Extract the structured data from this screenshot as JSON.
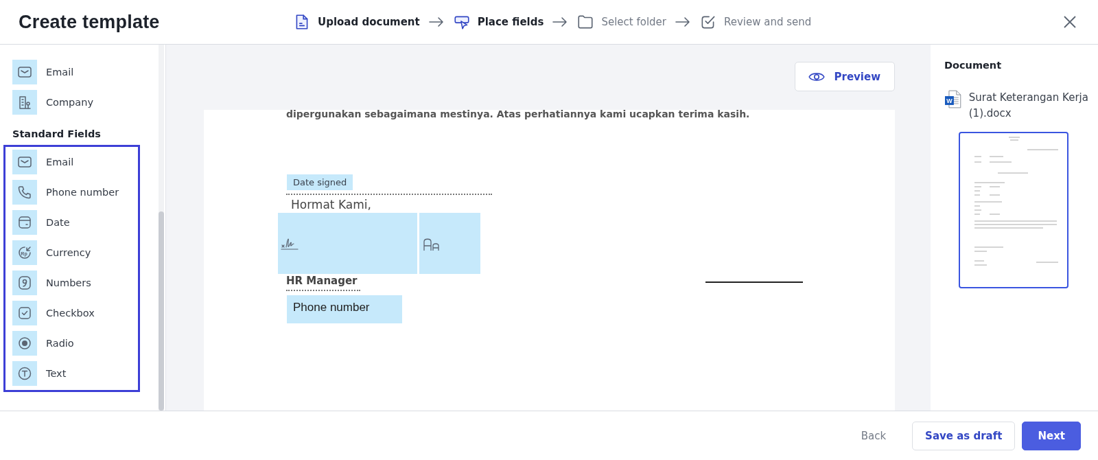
{
  "header": {
    "title": "Create template",
    "steps": [
      {
        "label": "Upload document",
        "kind": "document",
        "active": true
      },
      {
        "label": "Place fields",
        "kind": "pointer",
        "active": true
      },
      {
        "label": "Select folder",
        "kind": "folder",
        "active": false
      },
      {
        "label": "Review and send",
        "kind": "check",
        "active": false
      }
    ]
  },
  "sidebar": {
    "contact_fields": [
      {
        "label": "Email",
        "kind": "email"
      },
      {
        "label": "Company",
        "kind": "company"
      }
    ],
    "standard_fields": {
      "heading": "Standard Fields",
      "highlighted": true,
      "items": [
        {
          "label": "Email",
          "kind": "email"
        },
        {
          "label": "Phone number",
          "kind": "phone"
        },
        {
          "label": "Date",
          "kind": "date"
        },
        {
          "label": "Currency",
          "kind": "currency",
          "icon_text": "Rp"
        },
        {
          "label": "Numbers",
          "kind": "numbers"
        },
        {
          "label": "Checkbox",
          "kind": "checkbox"
        },
        {
          "label": "Radio",
          "kind": "radio"
        },
        {
          "label": "Text",
          "kind": "text"
        }
      ]
    }
  },
  "preview_button": "Preview",
  "document": {
    "lines": [
      {
        "kind": "paragraph",
        "text": "dipergunakan sebagaimana mestinya. Atas perhatiannya kami ucapkan terima kasih."
      },
      {
        "kind": "closing",
        "text": "Hormat Kami,"
      },
      {
        "kind": "role",
        "text": "HR Manager"
      }
    ],
    "fields": [
      {
        "kind": "label",
        "text": "Date signed"
      },
      {
        "kind": "signature"
      },
      {
        "kind": "text_field"
      },
      {
        "kind": "input",
        "text": "Phone number"
      }
    ]
  },
  "document_panel": {
    "heading": "Document",
    "file_badge": "W",
    "file_name": "Surat Keterangan Kerja (1).docx",
    "thumbnail_selected": true
  },
  "footer": {
    "buttons": [
      {
        "label": "Back",
        "kind": "link"
      },
      {
        "label": "Save as draft",
        "kind": "secondary"
      },
      {
        "label": "Next",
        "kind": "primary"
      }
    ]
  }
}
